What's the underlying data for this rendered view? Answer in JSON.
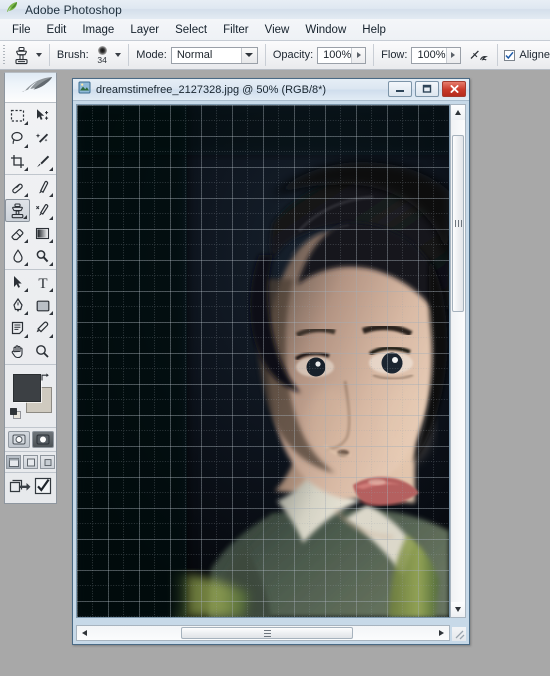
{
  "app": {
    "title": "Adobe Photoshop",
    "icon": "feather-icon"
  },
  "menubar": {
    "items": [
      {
        "label": "File"
      },
      {
        "label": "Edit"
      },
      {
        "label": "Image"
      },
      {
        "label": "Layer"
      },
      {
        "label": "Select"
      },
      {
        "label": "Filter"
      },
      {
        "label": "View"
      },
      {
        "label": "Window"
      },
      {
        "label": "Help"
      }
    ]
  },
  "options_bar": {
    "tool_icon": "clone-stamp-icon",
    "brush_label": "Brush:",
    "brush_size": "34",
    "mode_label": "Mode:",
    "mode_value": "Normal",
    "opacity_label": "Opacity:",
    "opacity_value": "100%",
    "flow_label": "Flow:",
    "flow_value": "100%",
    "airbrush_icon": "airbrush-icon",
    "aligned_label": "Aligne",
    "aligned_checked": true
  },
  "toolbox": {
    "logo_icon": "feather-logo-icon",
    "groups": [
      {
        "rows": [
          {
            "left": {
              "icon": "marquee-tool-icon",
              "has_flyout": true,
              "active": false
            },
            "right": {
              "icon": "move-tool-icon",
              "has_flyout": false,
              "active": false
            }
          },
          {
            "left": {
              "icon": "lasso-tool-icon",
              "has_flyout": true,
              "active": false
            },
            "right": {
              "icon": "magic-wand-tool-icon",
              "has_flyout": false,
              "active": false
            }
          },
          {
            "left": {
              "icon": "crop-tool-icon",
              "has_flyout": true,
              "active": false
            },
            "right": {
              "icon": "slice-tool-icon",
              "has_flyout": true,
              "active": false
            }
          }
        ]
      },
      {
        "rows": [
          {
            "left": {
              "icon": "healing-brush-tool-icon",
              "has_flyout": true,
              "active": false
            },
            "right": {
              "icon": "brush-tool-icon",
              "has_flyout": true,
              "active": false
            }
          },
          {
            "left": {
              "icon": "clone-stamp-tool-icon",
              "has_flyout": true,
              "active": true
            },
            "right": {
              "icon": "history-brush-tool-icon",
              "has_flyout": true,
              "active": false
            }
          },
          {
            "left": {
              "icon": "eraser-tool-icon",
              "has_flyout": true,
              "active": false
            },
            "right": {
              "icon": "gradient-tool-icon",
              "has_flyout": true,
              "active": false
            }
          },
          {
            "left": {
              "icon": "blur-tool-icon",
              "has_flyout": true,
              "active": false
            },
            "right": {
              "icon": "dodge-tool-icon",
              "has_flyout": true,
              "active": false
            }
          }
        ]
      },
      {
        "rows": [
          {
            "left": {
              "icon": "path-selection-tool-icon",
              "has_flyout": true,
              "active": false
            },
            "right": {
              "icon": "type-tool-icon",
              "has_flyout": true,
              "active": false
            }
          },
          {
            "left": {
              "icon": "pen-tool-icon",
              "has_flyout": true,
              "active": false
            },
            "right": {
              "icon": "rectangle-shape-tool-icon",
              "has_flyout": true,
              "active": false
            }
          },
          {
            "left": {
              "icon": "notes-tool-icon",
              "has_flyout": true,
              "active": false
            },
            "right": {
              "icon": "eyedropper-tool-icon",
              "has_flyout": true,
              "active": false
            }
          },
          {
            "left": {
              "icon": "hand-tool-icon",
              "has_flyout": false,
              "active": false
            },
            "right": {
              "icon": "zoom-tool-icon",
              "has_flyout": false,
              "active": false
            }
          }
        ]
      }
    ],
    "foreground_color": "#3c4044",
    "background_color": "#cfcabf",
    "swap-colors-icon": "swap-colors-icon",
    "default-colors-icon": "default-colors-icon",
    "mode_buttons": [
      {
        "icon": "standard-mask-mode-icon",
        "selected": true
      },
      {
        "icon": "quick-mask-mode-icon",
        "selected": false
      }
    ],
    "screen_buttons": [
      {
        "icon": "standard-screen-mode-icon",
        "selected": true
      },
      {
        "icon": "full-screen-menubar-mode-icon",
        "selected": false
      },
      {
        "icon": "full-screen-mode-icon",
        "selected": false
      }
    ],
    "jump_buttons": [
      {
        "icon": "jump-to-imageready-icon"
      },
      {
        "icon": "edit-in-imageready-icon"
      }
    ]
  },
  "document": {
    "icon": "photoshop-document-icon",
    "title": "dreamstimefree_2127328.jpg @ 50% (RGB/8*)",
    "filename": "dreamstimefree_2127328.jpg",
    "zoom": "50%",
    "color_mode": "RGB/8*",
    "window_buttons": [
      {
        "name": "minimize",
        "icon": "minimize-icon"
      },
      {
        "name": "maximize",
        "icon": "maximize-icon"
      },
      {
        "name": "close",
        "icon": "close-icon"
      }
    ],
    "grid_visible": true,
    "grid_major_spacing_px": 31,
    "grid_subdivisions": 2,
    "grid_color": "#8f9aa3",
    "canvas_background": "#0b1019",
    "scrollbars": {
      "vertical": {
        "thumb_top_pct": 6,
        "thumb_height_pct": 34
      },
      "horizontal": {
        "thumb_left_pct": 28,
        "thumb_width_pct": 46
      }
    }
  },
  "workspace": {
    "background_color": "#a8a8a8"
  }
}
